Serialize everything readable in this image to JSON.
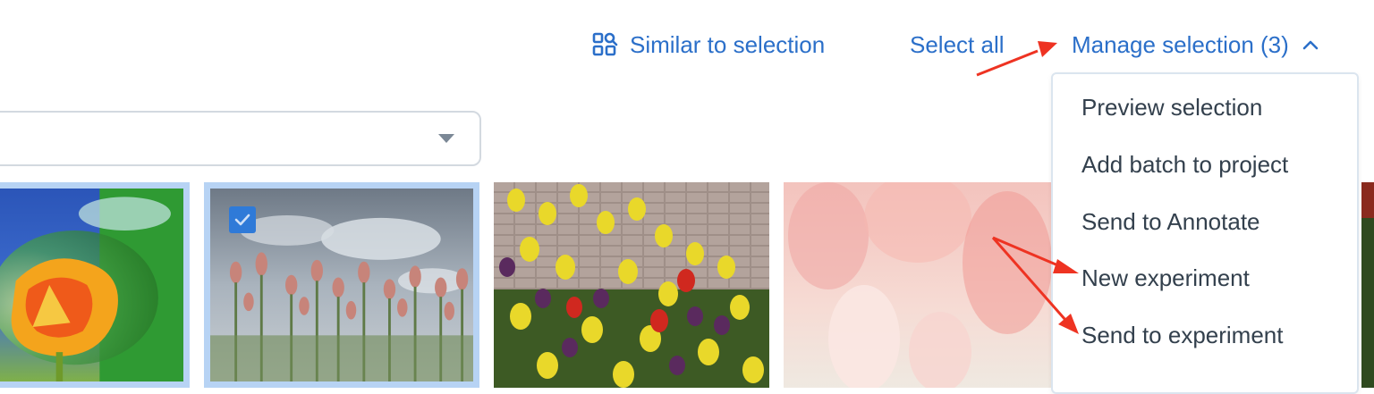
{
  "toolbar": {
    "similar_label": "Similar to selection",
    "select_all_label": "Select all",
    "manage_label": "Manage selection (3)"
  },
  "dropdown": {
    "items": [
      "Preview selection",
      "Add batch to project",
      "Send to Annotate",
      "New experiment",
      "Send to experiment"
    ]
  },
  "icons": {
    "similar": "similar-selection-icon",
    "manage_toggle": "chevron-up-icon",
    "filter_toggle": "caret-down-icon",
    "check": "checkmark-icon"
  },
  "colors": {
    "link": "#2b6fc9",
    "selected_border": "#b7d3f4",
    "checkbox": "#2f7ad8",
    "annotation_arrow": "#ee3322"
  },
  "gallery": {
    "images": [
      {
        "name": "tulip-image-1",
        "selected": true
      },
      {
        "name": "tulip-image-2",
        "selected": true
      },
      {
        "name": "tulip-image-3",
        "selected": false
      },
      {
        "name": "tulip-image-4",
        "selected": false
      },
      {
        "name": "tulip-image-5",
        "selected": false
      }
    ]
  }
}
